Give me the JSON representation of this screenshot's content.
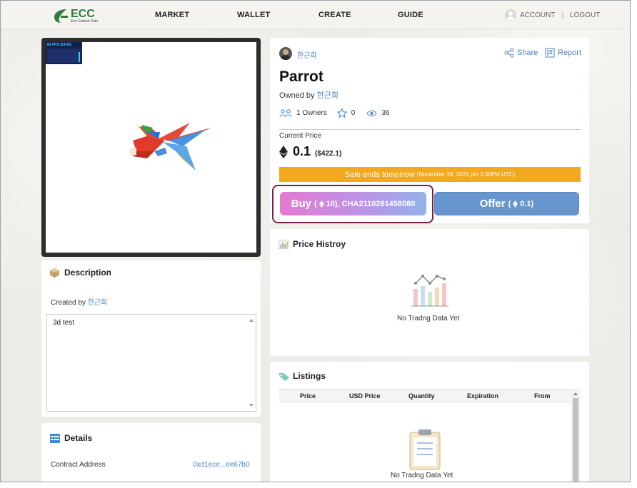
{
  "header": {
    "logo_title": "ECC",
    "logo_sub": "Eco Carbon Coin",
    "nav": [
      "MARKET",
      "WALLET",
      "CREATE",
      "GUIDE"
    ],
    "account": "ACCOUNT",
    "separator": "|",
    "logout": "LOGOUT"
  },
  "viewer": {
    "fps": "60 FPS (24-60)"
  },
  "description": {
    "title": "Description",
    "created_by_label": "Created by",
    "creator": "한근희",
    "text": "3d test"
  },
  "details": {
    "title": "Details",
    "contract_label": "Contract Address",
    "contract_value": "0xd1ece...ee67b0"
  },
  "item": {
    "owner_name": "한근희",
    "share": "Share",
    "report": "Report",
    "name": "Parrot",
    "owned_by_label": "Owned by",
    "owned_by": "한근희",
    "owners": "1 Owners",
    "favorites": "0",
    "views": "36",
    "current_price_label": "Current Price",
    "price": "0.1",
    "price_usd": "($422.1)",
    "sale_ends": "Sale ends tomorrow",
    "sale_date": "(November 28, 2021 pm 2:00PM UTC)"
  },
  "buttons": {
    "buy_label": "Buy",
    "buy_amount": "(",
    "buy_value": "10), CHA2110281458080",
    "offer_label": "Offer",
    "offer_open": "(",
    "offer_value": "0.1)"
  },
  "price_history": {
    "title": "Price Histroy",
    "empty": "No Tradng Data Yet"
  },
  "listings": {
    "title": "Listings",
    "columns": [
      "Price",
      "USD Price",
      "Quantity",
      "Expiration",
      "From"
    ],
    "empty": "No Tradng Data Yet"
  },
  "colors": {
    "accent_blue": "#4a82c4",
    "brand_green": "#2f7d3a",
    "sale_orange": "#f4a81d",
    "offer_blue": "#6796cf"
  }
}
